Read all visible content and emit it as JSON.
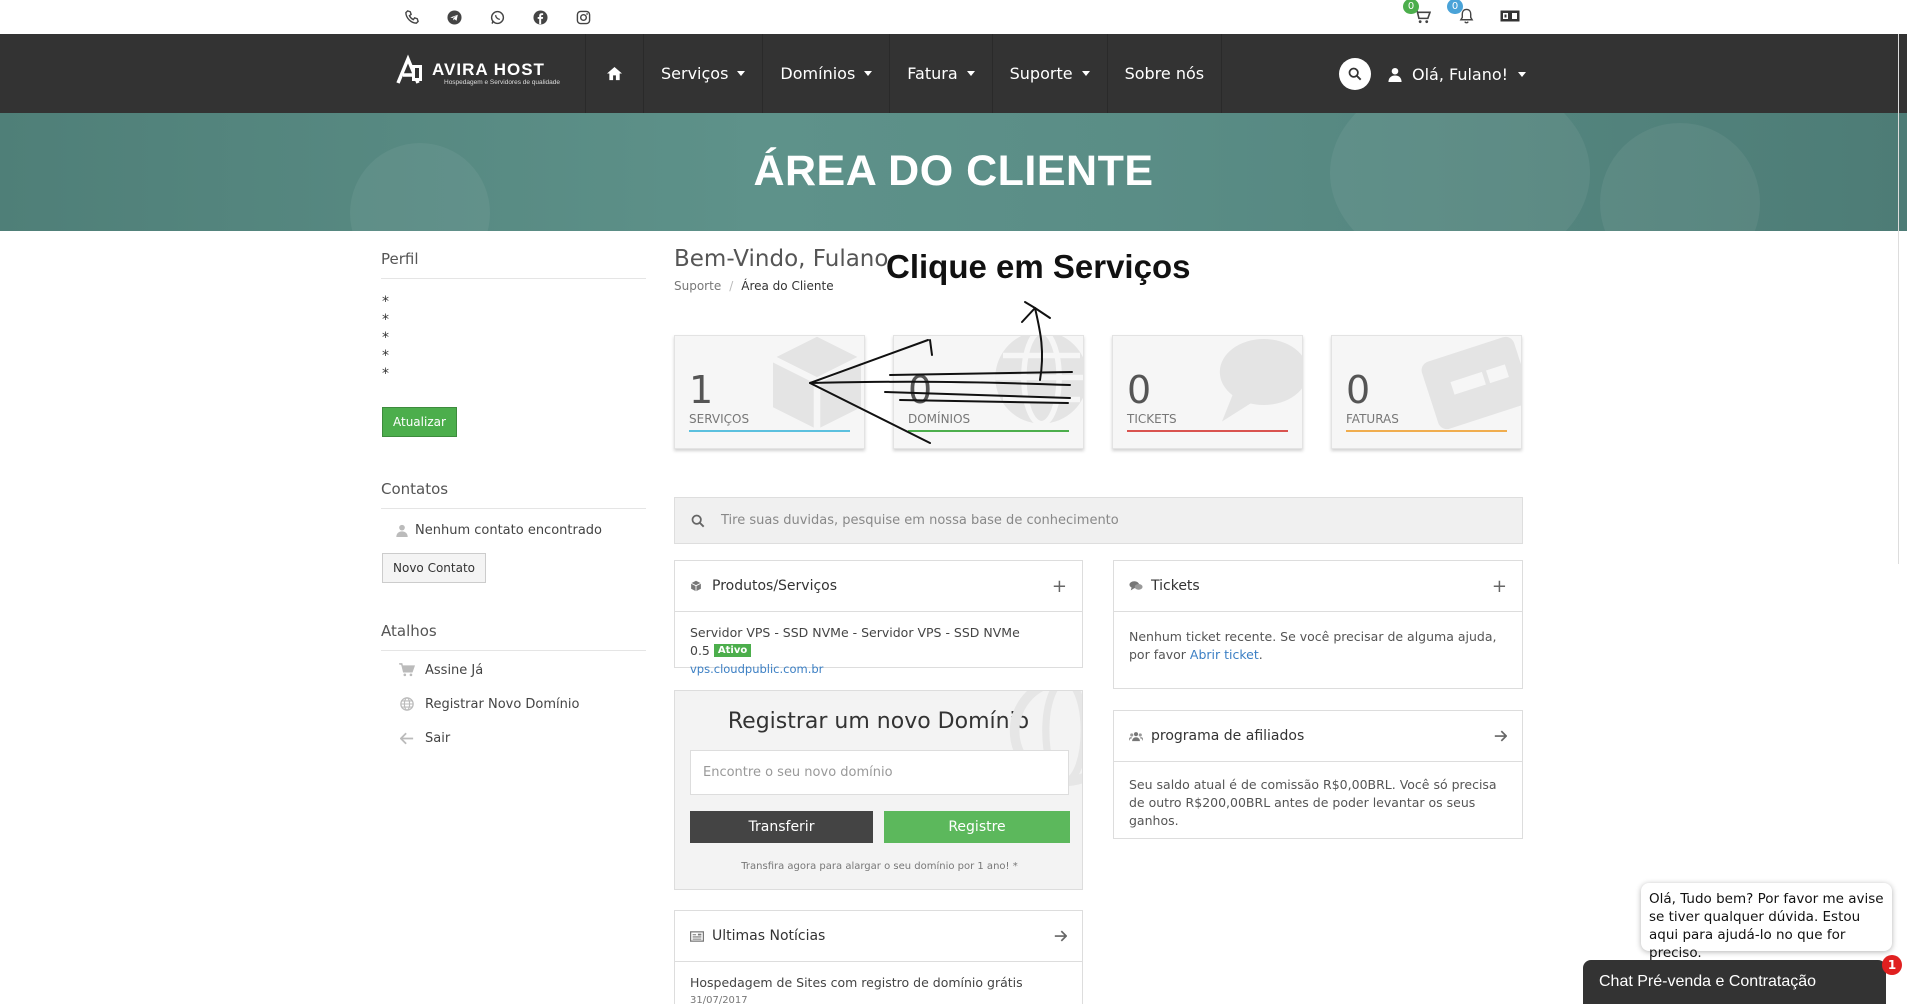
{
  "brand": {
    "name": "AVIRA HOST",
    "tagline": "Hospedagem e Servidores de qualidade"
  },
  "topbar": {
    "cart_count": "0",
    "notif_count": "0"
  },
  "nav": {
    "items": [
      {
        "label": "Serviços"
      },
      {
        "label": "Domínios"
      },
      {
        "label": "Fatura"
      },
      {
        "label": "Suporte"
      },
      {
        "label": "Sobre nós"
      }
    ],
    "user_label": "Olá, Fulano!"
  },
  "hero": {
    "title": "ÁREA DO CLIENTE"
  },
  "sidebar": {
    "profile_title": "Perfil",
    "profile_lines": [
      "*",
      "*",
      "*",
      "*",
      "*"
    ],
    "update_button": "Atualizar",
    "contacts_title": "Contatos",
    "no_contacts": "Nenhum contato encontrado",
    "new_contact_button": "Novo Contato",
    "shortcuts_title": "Atalhos",
    "shortcuts": [
      {
        "label": "Assine Já",
        "icon": "cart-icon"
      },
      {
        "label": "Registrar Novo Domínio",
        "icon": "globe-icon"
      },
      {
        "label": "Sair",
        "icon": "arrow-left-icon"
      }
    ]
  },
  "main": {
    "welcome": "Bem-Vindo, Fulano",
    "breadcrumb": [
      "Suporte",
      "Área do Cliente"
    ],
    "annotation": "Clique em Serviços",
    "tiles": [
      {
        "count": "1",
        "label": "SERVIÇOS",
        "color": "#5bc0de"
      },
      {
        "count": "0",
        "label": "DOMÍNIOS",
        "color": "#4cae4c"
      },
      {
        "count": "0",
        "label": "TICKETS",
        "color": "#d9534f"
      },
      {
        "count": "0",
        "label": "FATURAS",
        "color": "#f0ad4e"
      }
    ],
    "kb_search_placeholder": "Tire suas duvidas, pesquise em nossa base de conhecimento",
    "products_panel": {
      "title": "Produtos/Serviços",
      "service_name": "Servidor VPS - SSD NVMe - Servidor VPS - SSD NVMe 0.5",
      "status": "Ativo",
      "domain": "vps.cloudpublic.com.br"
    },
    "tickets_panel": {
      "title": "Tickets",
      "text": "Nenhum ticket recente. Se você precisar de alguma ajuda, por favor ",
      "link": "Abrir ticket",
      "after": "."
    },
    "affiliate_panel": {
      "title": "programa de afiliados",
      "text": "Seu saldo atual é de comissão R$0,00BRL. Você só precisa de outro R$200,00BRL antes de poder levantar os seus ganhos."
    },
    "domain_box": {
      "title": "Registrar um novo Domínio",
      "placeholder": "Encontre o seu novo domínio",
      "transfer_button": "Transferir",
      "register_button": "Registre",
      "note": "Transfira agora para alargar o seu domínio por 1 ano! *"
    },
    "news_panel": {
      "title": "Ultimas Notícias",
      "item_title": "Hospedagem de Sites com registro de domínio grátis",
      "item_date": "31/07/2017"
    }
  },
  "chat": {
    "message": "Olá, Tudo bem? Por favor me avise se tiver qualquer dúvida. Estou aqui para ajudá-lo no que for preciso.",
    "bar_label": "Chat Pré-venda e Contratação",
    "unread": "1"
  }
}
